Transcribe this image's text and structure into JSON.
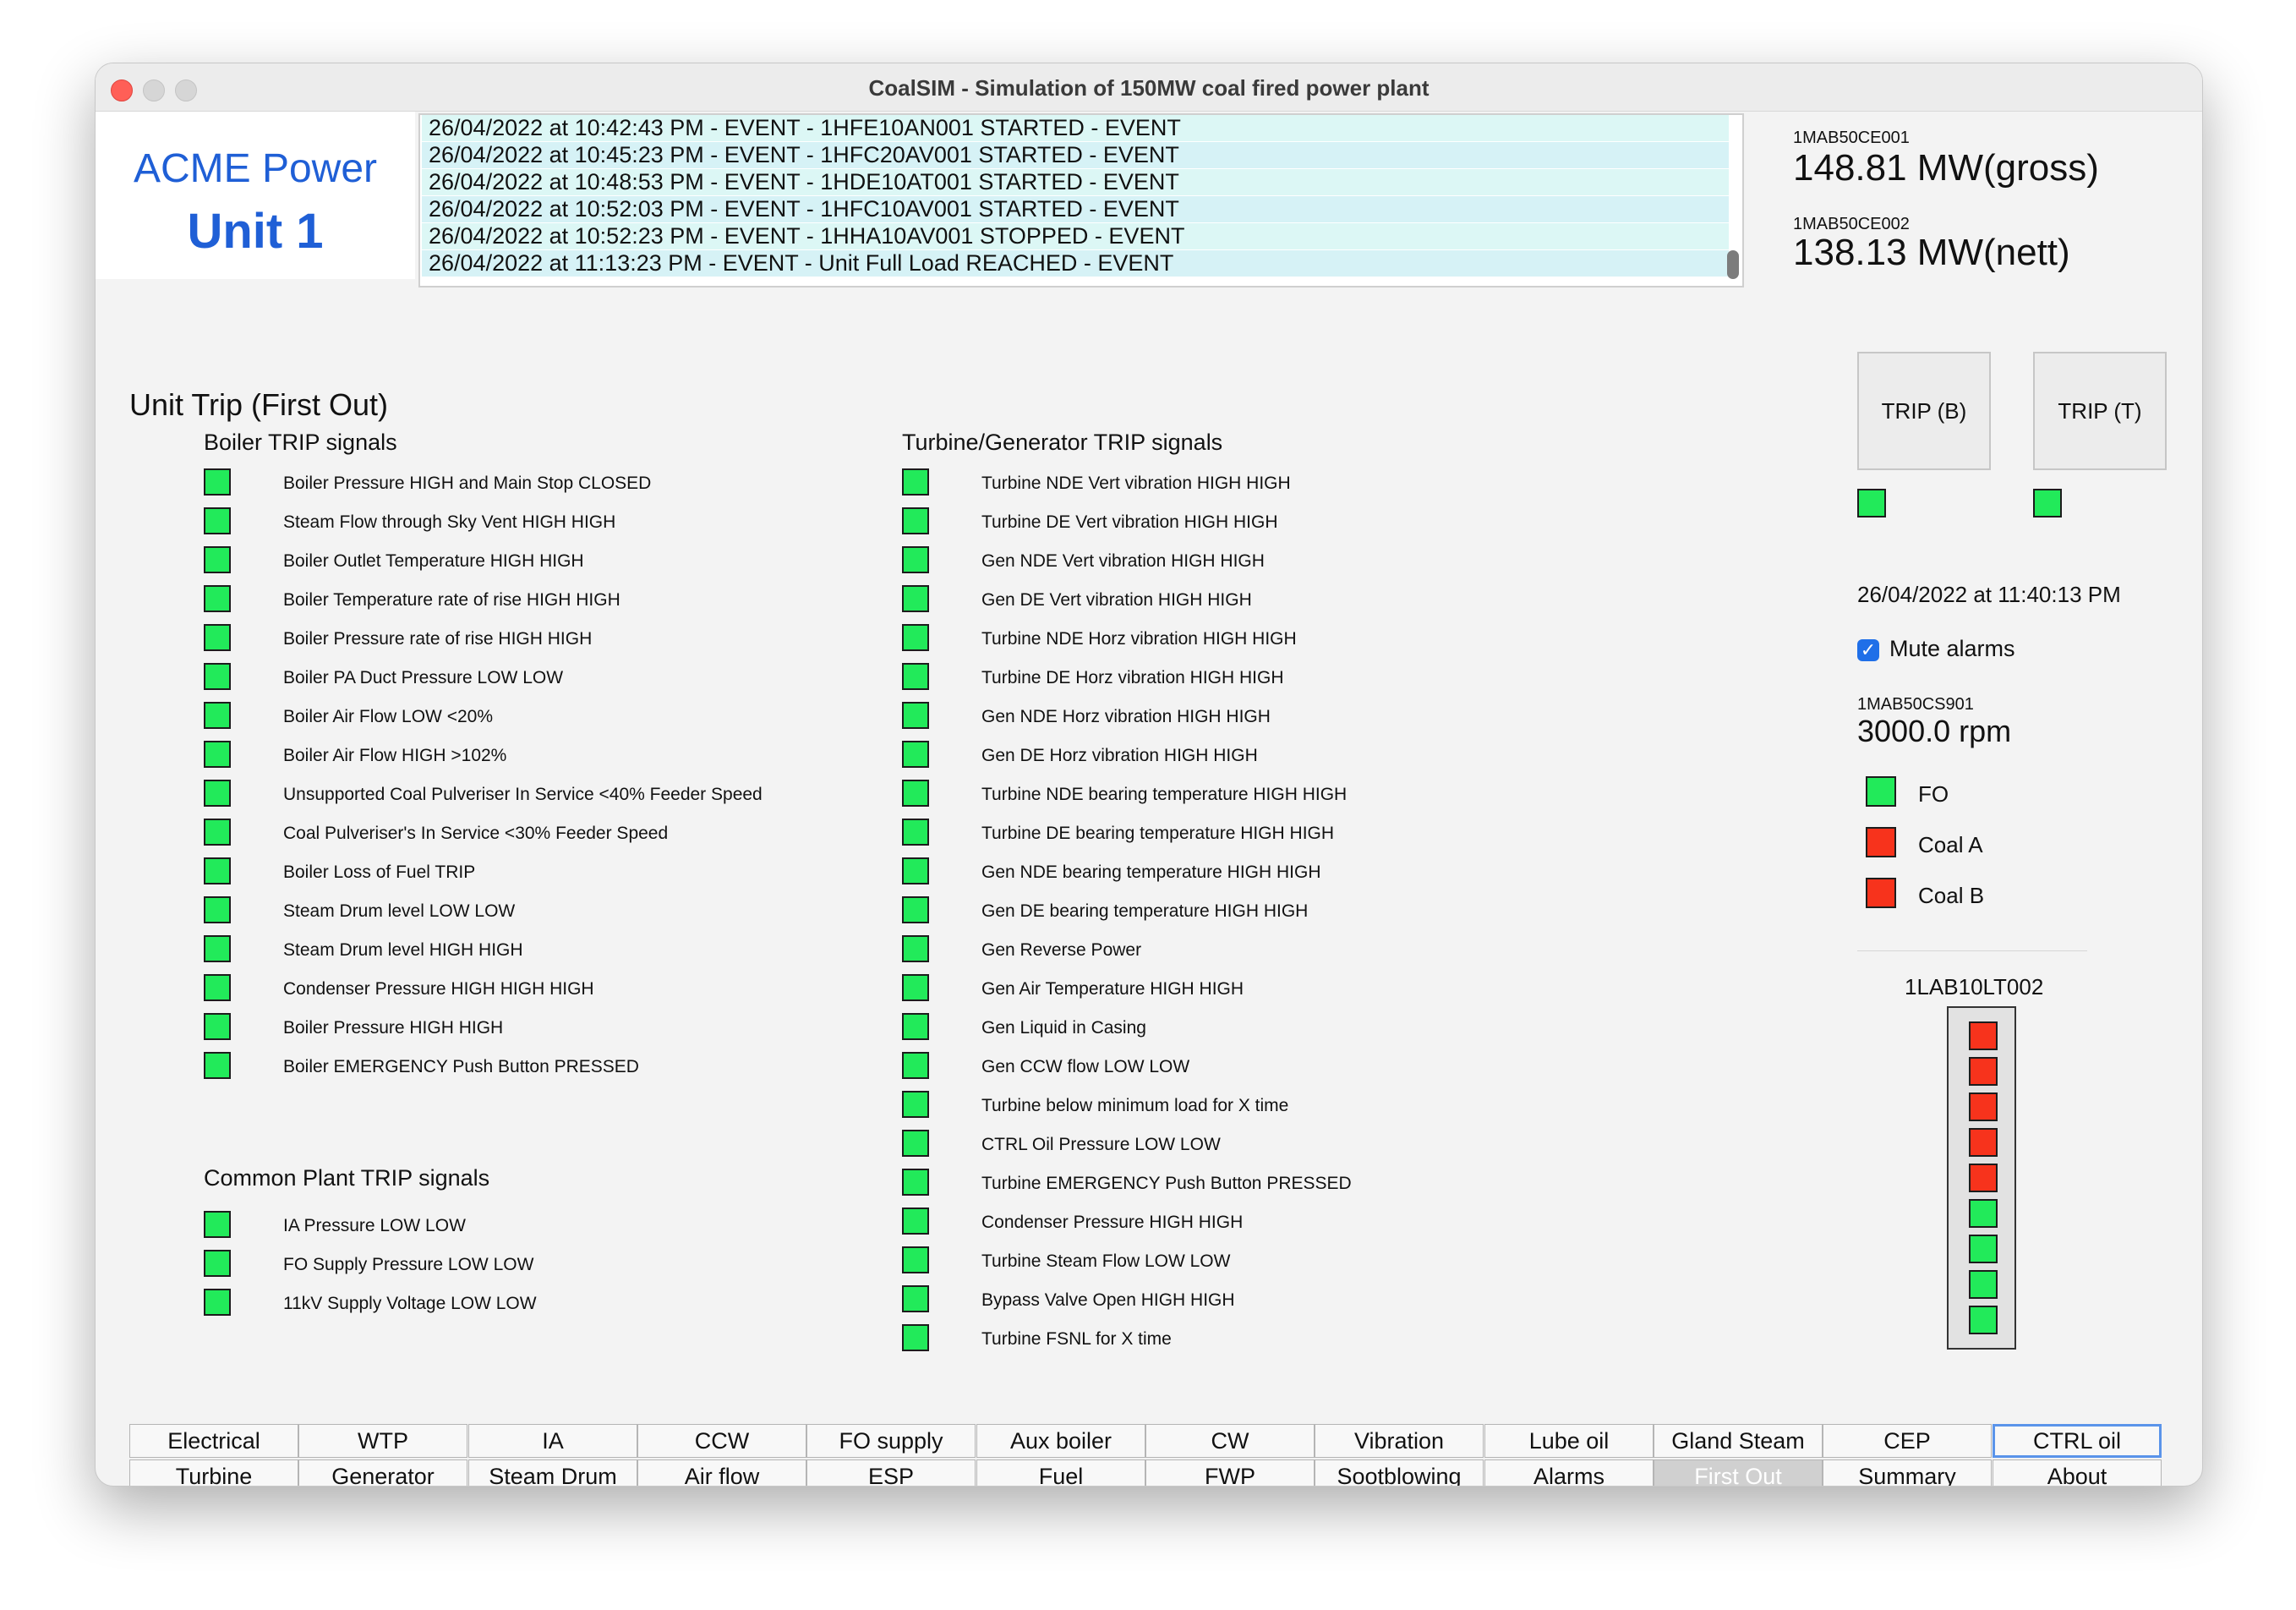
{
  "window": {
    "title": "CoalSIM - Simulation of 150MW coal fired power plant"
  },
  "brand": {
    "company": "ACME Power",
    "unit": "Unit 1"
  },
  "events": [
    "26/04/2022 at 10:42:43 PM - EVENT - 1HFE10AN001 STARTED - EVENT",
    "26/04/2022 at 10:45:23 PM - EVENT - 1HFC20AV001 STARTED - EVENT",
    "26/04/2022 at 10:48:53 PM - EVENT - 1HDE10AT001 STARTED - EVENT",
    "26/04/2022 at 10:52:03 PM - EVENT - 1HFC10AV001 STARTED - EVENT",
    "26/04/2022 at 10:52:23 PM - EVENT - 1HHA10AV001 STOPPED - EVENT",
    "26/04/2022 at 11:13:23 PM - EVENT - Unit Full Load REACHED - EVENT"
  ],
  "output": {
    "gross_tag": "1MAB50CE001",
    "gross_value": "148.81 MW(gross)",
    "nett_tag": "1MAB50CE002",
    "nett_value": "138.13 MW(nett)"
  },
  "page": {
    "title": "Unit Trip (First Out)"
  },
  "boiler": {
    "title": "Boiler TRIP signals",
    "signals": [
      {
        "label": "Boiler Pressure HIGH and Main Stop CLOSED",
        "state": "green"
      },
      {
        "label": "Steam Flow through Sky Vent HIGH HIGH",
        "state": "green"
      },
      {
        "label": "Boiler Outlet Temperature HIGH HIGH",
        "state": "green"
      },
      {
        "label": "Boiler Temperature rate of rise HIGH HIGH",
        "state": "green"
      },
      {
        "label": "Boiler Pressure rate of rise HIGH HIGH",
        "state": "green"
      },
      {
        "label": "Boiler PA Duct Pressure LOW LOW",
        "state": "green"
      },
      {
        "label": "Boiler Air Flow LOW <20%",
        "state": "green"
      },
      {
        "label": "Boiler Air Flow HIGH >102%",
        "state": "green"
      },
      {
        "label": "Unsupported Coal Pulveriser In Service <40% Feeder Speed",
        "state": "green"
      },
      {
        "label": "Coal Pulveriser's In Service <30% Feeder Speed",
        "state": "green"
      },
      {
        "label": "Boiler Loss of Fuel TRIP",
        "state": "green"
      },
      {
        "label": "Steam Drum level LOW LOW",
        "state": "green"
      },
      {
        "label": "Steam Drum level HIGH HIGH",
        "state": "green"
      },
      {
        "label": "Condenser Pressure HIGH HIGH HIGH",
        "state": "green"
      },
      {
        "label": "Boiler Pressure HIGH HIGH",
        "state": "green"
      },
      {
        "label": "Boiler EMERGENCY Push Button PRESSED",
        "state": "green"
      }
    ]
  },
  "common": {
    "title": "Common Plant TRIP signals",
    "signals": [
      {
        "label": "IA Pressure LOW LOW",
        "state": "green"
      },
      {
        "label": "FO Supply Pressure LOW LOW",
        "state": "green"
      },
      {
        "label": "11kV Supply Voltage LOW LOW",
        "state": "green"
      }
    ]
  },
  "turbine": {
    "title": "Turbine/Generator TRIP signals",
    "signals": [
      {
        "label": "Turbine NDE Vert vibration HIGH HIGH",
        "state": "green"
      },
      {
        "label": "Turbine DE Vert vibration HIGH HIGH",
        "state": "green"
      },
      {
        "label": "Gen NDE Vert vibration HIGH HIGH",
        "state": "green"
      },
      {
        "label": "Gen DE Vert vibration HIGH HIGH",
        "state": "green"
      },
      {
        "label": "Turbine NDE Horz vibration HIGH HIGH",
        "state": "green"
      },
      {
        "label": "Turbine DE Horz vibration HIGH HIGH",
        "state": "green"
      },
      {
        "label": "Gen NDE Horz vibration HIGH HIGH",
        "state": "green"
      },
      {
        "label": "Gen DE Horz vibration HIGH HIGH",
        "state": "green"
      },
      {
        "label": "Turbine NDE bearing temperature HIGH HIGH",
        "state": "green"
      },
      {
        "label": "Turbine DE bearing temperature HIGH HIGH",
        "state": "green"
      },
      {
        "label": "Gen NDE bearing temperature HIGH HIGH",
        "state": "green"
      },
      {
        "label": "Gen DE bearing temperature HIGH HIGH",
        "state": "green"
      },
      {
        "label": "Gen Reverse Power",
        "state": "green"
      },
      {
        "label": "Gen Air Temperature HIGH HIGH",
        "state": "green"
      },
      {
        "label": "Gen Liquid in Casing",
        "state": "green"
      },
      {
        "label": "Gen CCW flow LOW LOW",
        "state": "green"
      },
      {
        "label": "Turbine below minimum load for X time",
        "state": "green"
      },
      {
        "label": "CTRL Oil Pressure LOW LOW",
        "state": "green"
      },
      {
        "label": "Turbine EMERGENCY Push Button PRESSED",
        "state": "green"
      },
      {
        "label": "Condenser Pressure HIGH HIGH",
        "state": "green"
      },
      {
        "label": "Turbine Steam Flow LOW LOW",
        "state": "green"
      },
      {
        "label": "Bypass Valve Open HIGH HIGH",
        "state": "green"
      },
      {
        "label": "Turbine FSNL for X time",
        "state": "green"
      }
    ]
  },
  "trip": {
    "boiler_label": "TRIP (B)",
    "boiler_state": "green",
    "turbine_label": "TRIP (T)",
    "turbine_state": "green"
  },
  "status": {
    "datetime": "26/04/2022 at 11:40:13 PM",
    "mute_label": "Mute alarms",
    "mute_checked": true,
    "speed_tag": "1MAB50CS901",
    "speed_value": "3000.0 rpm"
  },
  "fuel": [
    {
      "label": "FO",
      "state": "green"
    },
    {
      "label": "Coal A",
      "state": "red"
    },
    {
      "label": "Coal B",
      "state": "red"
    }
  ],
  "level": {
    "tag": "1LAB10LT002",
    "cells": [
      "red",
      "red",
      "red",
      "red",
      "red",
      "green",
      "green",
      "green",
      "green"
    ]
  },
  "colors": {
    "green": "#22ea5a",
    "red": "#f7331c",
    "brand": "#1f5fd6"
  },
  "tabs": {
    "row1": [
      "Electrical",
      "WTP",
      "IA",
      "CCW",
      "FO supply",
      "Aux boiler",
      "CW",
      "Vibration",
      "Lube oil",
      "Gland Steam",
      "CEP",
      "CTRL oil"
    ],
    "row2": [
      "Turbine",
      "Generator",
      "Steam Drum",
      "Air flow",
      "ESP",
      "Fuel",
      "FWP",
      "Sootblowing",
      "Alarms",
      "First Out",
      "Summary",
      "About"
    ],
    "active": "First Out",
    "focused": "CTRL oil"
  }
}
